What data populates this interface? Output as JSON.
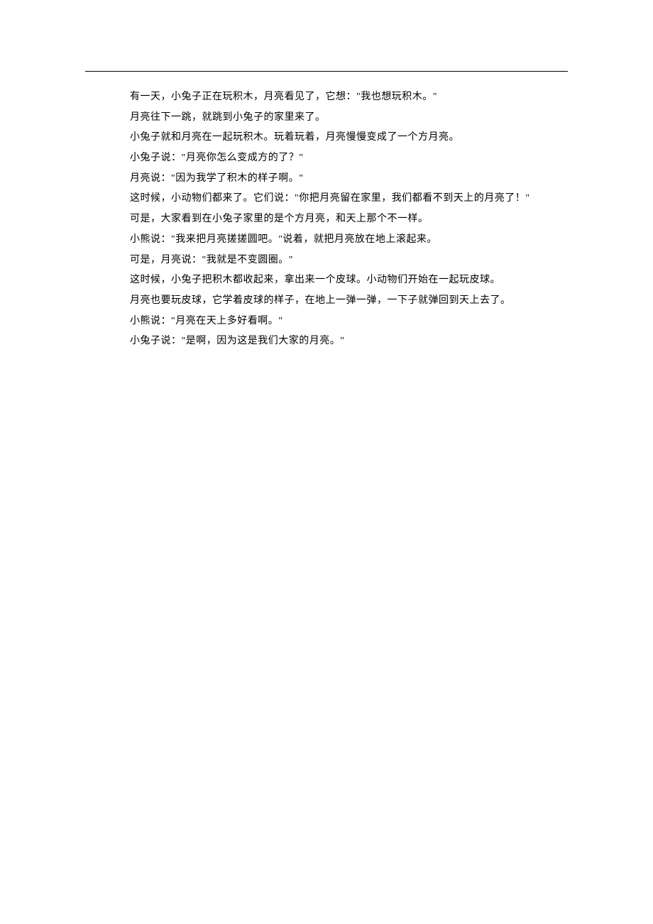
{
  "story": {
    "lines": [
      "有一天，小兔子正在玩积木，月亮看见了，它想：\"我也想玩积木。\"",
      "月亮往下一跳，就跳到小兔子的家里来了。",
      "小兔子就和月亮在一起玩积木。玩着玩着，月亮慢慢变成了一个方月亮。",
      "小兔子说：\"月亮你怎么变成方的了？\"",
      "月亮说：\"因为我学了积木的样子啊。\"",
      "这时候，小动物们都来了。它们说：\"你把月亮留在家里，我们都看不到天上的月亮了！\"",
      "可是，大家看到在小兔子家里的是个方月亮，和天上那个不一样。",
      "小熊说：\"我来把月亮搓搓圆吧。\"说着，就把月亮放在地上滚起来。",
      "可是，月亮说：\"我就是不变圆圈。\"",
      "这时候，小兔子把积木都收起来，拿出来一个皮球。小动物们开始在一起玩皮球。",
      "月亮也要玩皮球，它学着皮球的样子，在地上一弹一弹，一下子就弹回到天上去了。",
      "小熊说：\"月亮在天上多好看啊。\"",
      "小兔子说：\"是啊，因为这是我们大家的月亮。\""
    ]
  }
}
